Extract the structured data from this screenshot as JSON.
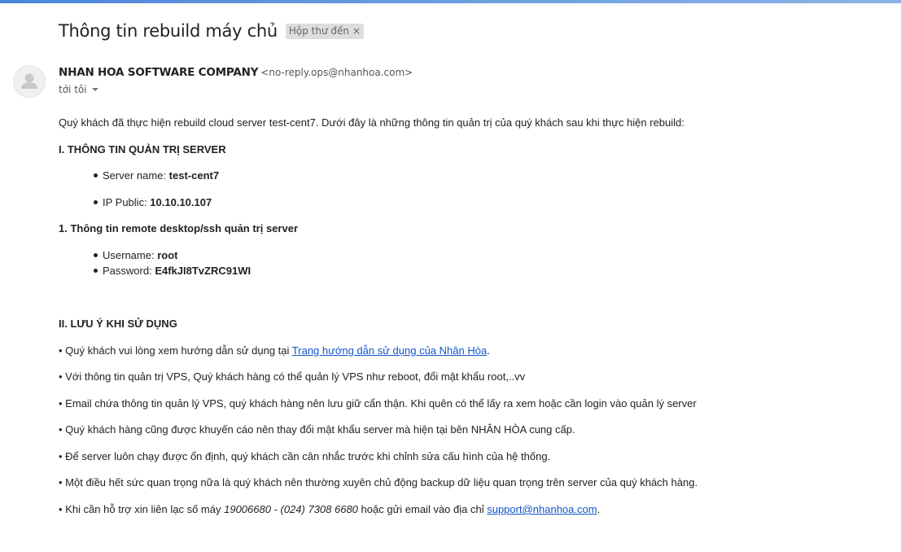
{
  "email": {
    "subject": "Thông tin rebuild máy chủ",
    "label": "Hộp thư đến",
    "label_remove": "×",
    "sender_name": "NHAN HOA SOFTWARE COMPANY",
    "sender_email": "<no-reply.ops@nhanhoa.com>",
    "to": "tới tôi"
  },
  "body": {
    "intro": "Quý khách đã thực hiện rebuild cloud server test-cent7. Dưới đây là những thông tin quản trị của quý khách sau khi thực hiện rebuild:",
    "section1_heading": "I. THÔNG TIN QUẢN TRỊ SERVER",
    "server_name_label": "Server name: ",
    "server_name_value": "test-cent7",
    "ip_label": "IP Public: ",
    "ip_value": "10.10.10.107",
    "remote_heading": "1. Thông tin remote desktop/ssh quản trị server",
    "username_label": "Username: ",
    "username_value": "root",
    "password_label": "Password: ",
    "password_value": "E4fkJI8TvZRC91WI",
    "section2_heading": "II. LƯU Ý KHI SỬ DỤNG",
    "note1_prefix": "• Quý khách vui lòng xem hướng dẫn sử dụng tại ",
    "note1_link": "Trang hướng dẫn sử dụng của Nhân Hòa",
    "note1_suffix": ".",
    "note2": "• Với thông tin quản trị VPS, Quý khách hàng có thể quản lý VPS như reboot, đổi mật khẩu root,..vv",
    "note3": "• Email chứa thông tin quản lý VPS, quý khách hàng nên lưu giữ cẩn thận. Khi quên có thể lấy ra xem hoặc cần login vào quản lý server",
    "note4": "• Quý khách hàng cũng được khuyến cáo nên thay đổi mật khẩu server mà hiện tại bên NHÂN HÒA cung cấp.",
    "note5": "• Để server luôn chạy được ổn định, quý khách cần cân nhắc trước khi chỉnh sửa cấu hình của hệ thống.",
    "note6": "• Một điều hết sức quan trọng nữa là quý khách nên thường xuyên chủ động backup dữ liệu quan trọng trên server của quý khách hàng.",
    "note7_prefix": "• Khi cần hỗ trợ xin liên lạc số máy ",
    "note7_phone": "19006680 - (024) 7308 6680",
    "note7_middle": " hoặc gửi email vào địa chỉ ",
    "note7_link": "support@nhanhoa.com",
    "note7_suffix": "."
  },
  "icons": {
    "avatar": "default-person-avatar-icon",
    "caret": "chevron-down-icon",
    "bullet": "bullet-dot-icon"
  },
  "colors": {
    "link": "#1155cc",
    "label_bg": "#dddddd",
    "top_bar": "#4a86d8"
  }
}
